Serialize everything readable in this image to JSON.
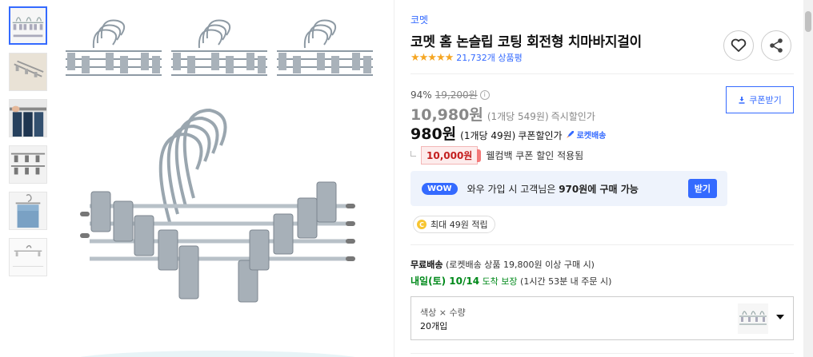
{
  "thumbnails": [
    {
      "name": "thumbnail-1",
      "active": true
    },
    {
      "name": "thumbnail-2",
      "active": false
    },
    {
      "name": "thumbnail-3",
      "active": false
    },
    {
      "name": "thumbnail-4",
      "active": false
    },
    {
      "name": "thumbnail-5",
      "active": false
    },
    {
      "name": "thumbnail-6",
      "active": false
    }
  ],
  "product": {
    "brand": "코멧",
    "title": "코멧 홈 논슬립 코팅 회전형 치마바지걸이",
    "stars": "★★★★★",
    "review_count": "21,732개 상품평"
  },
  "price": {
    "discount_rate": "94%",
    "original_price": "19,200원",
    "info_icon": "i",
    "sale_price": "10,980원",
    "sale_unit": "(1개당 549원)",
    "sale_label": "즉시할인가",
    "coupon_price": "980원",
    "coupon_unit": "(1개당 49원)",
    "coupon_label": "쿠폰할인가",
    "rocket_label": "로켓배송",
    "coupon_button": "쿠폰받기",
    "welcome_amount": "10,000원",
    "welcome_text": "웰컴백 쿠폰 할인 적용됨"
  },
  "wow": {
    "tag": "WOW",
    "text_pre": "와우 가입 시 고객님은 ",
    "text_bold": "970원에 구매 가능",
    "button": "받기"
  },
  "cashback": {
    "coin": "C",
    "text": "최대 49원 적립"
  },
  "shipping": {
    "title": "무료배송",
    "detail": "(로켓배송 상품 19,800원 이상 구매 시)",
    "arrival_date": "내일(토) 10/14",
    "arrival_guarantee": "도착 보장",
    "arrival_condition": "(1시간 53분 내 주문 시)"
  },
  "option": {
    "label": "색상 × 수량",
    "value": "20개입"
  },
  "colors": {
    "accent": "#346aff",
    "star": "#f5a623",
    "green": "#00891a",
    "welcome_red": "#c41f1f"
  }
}
